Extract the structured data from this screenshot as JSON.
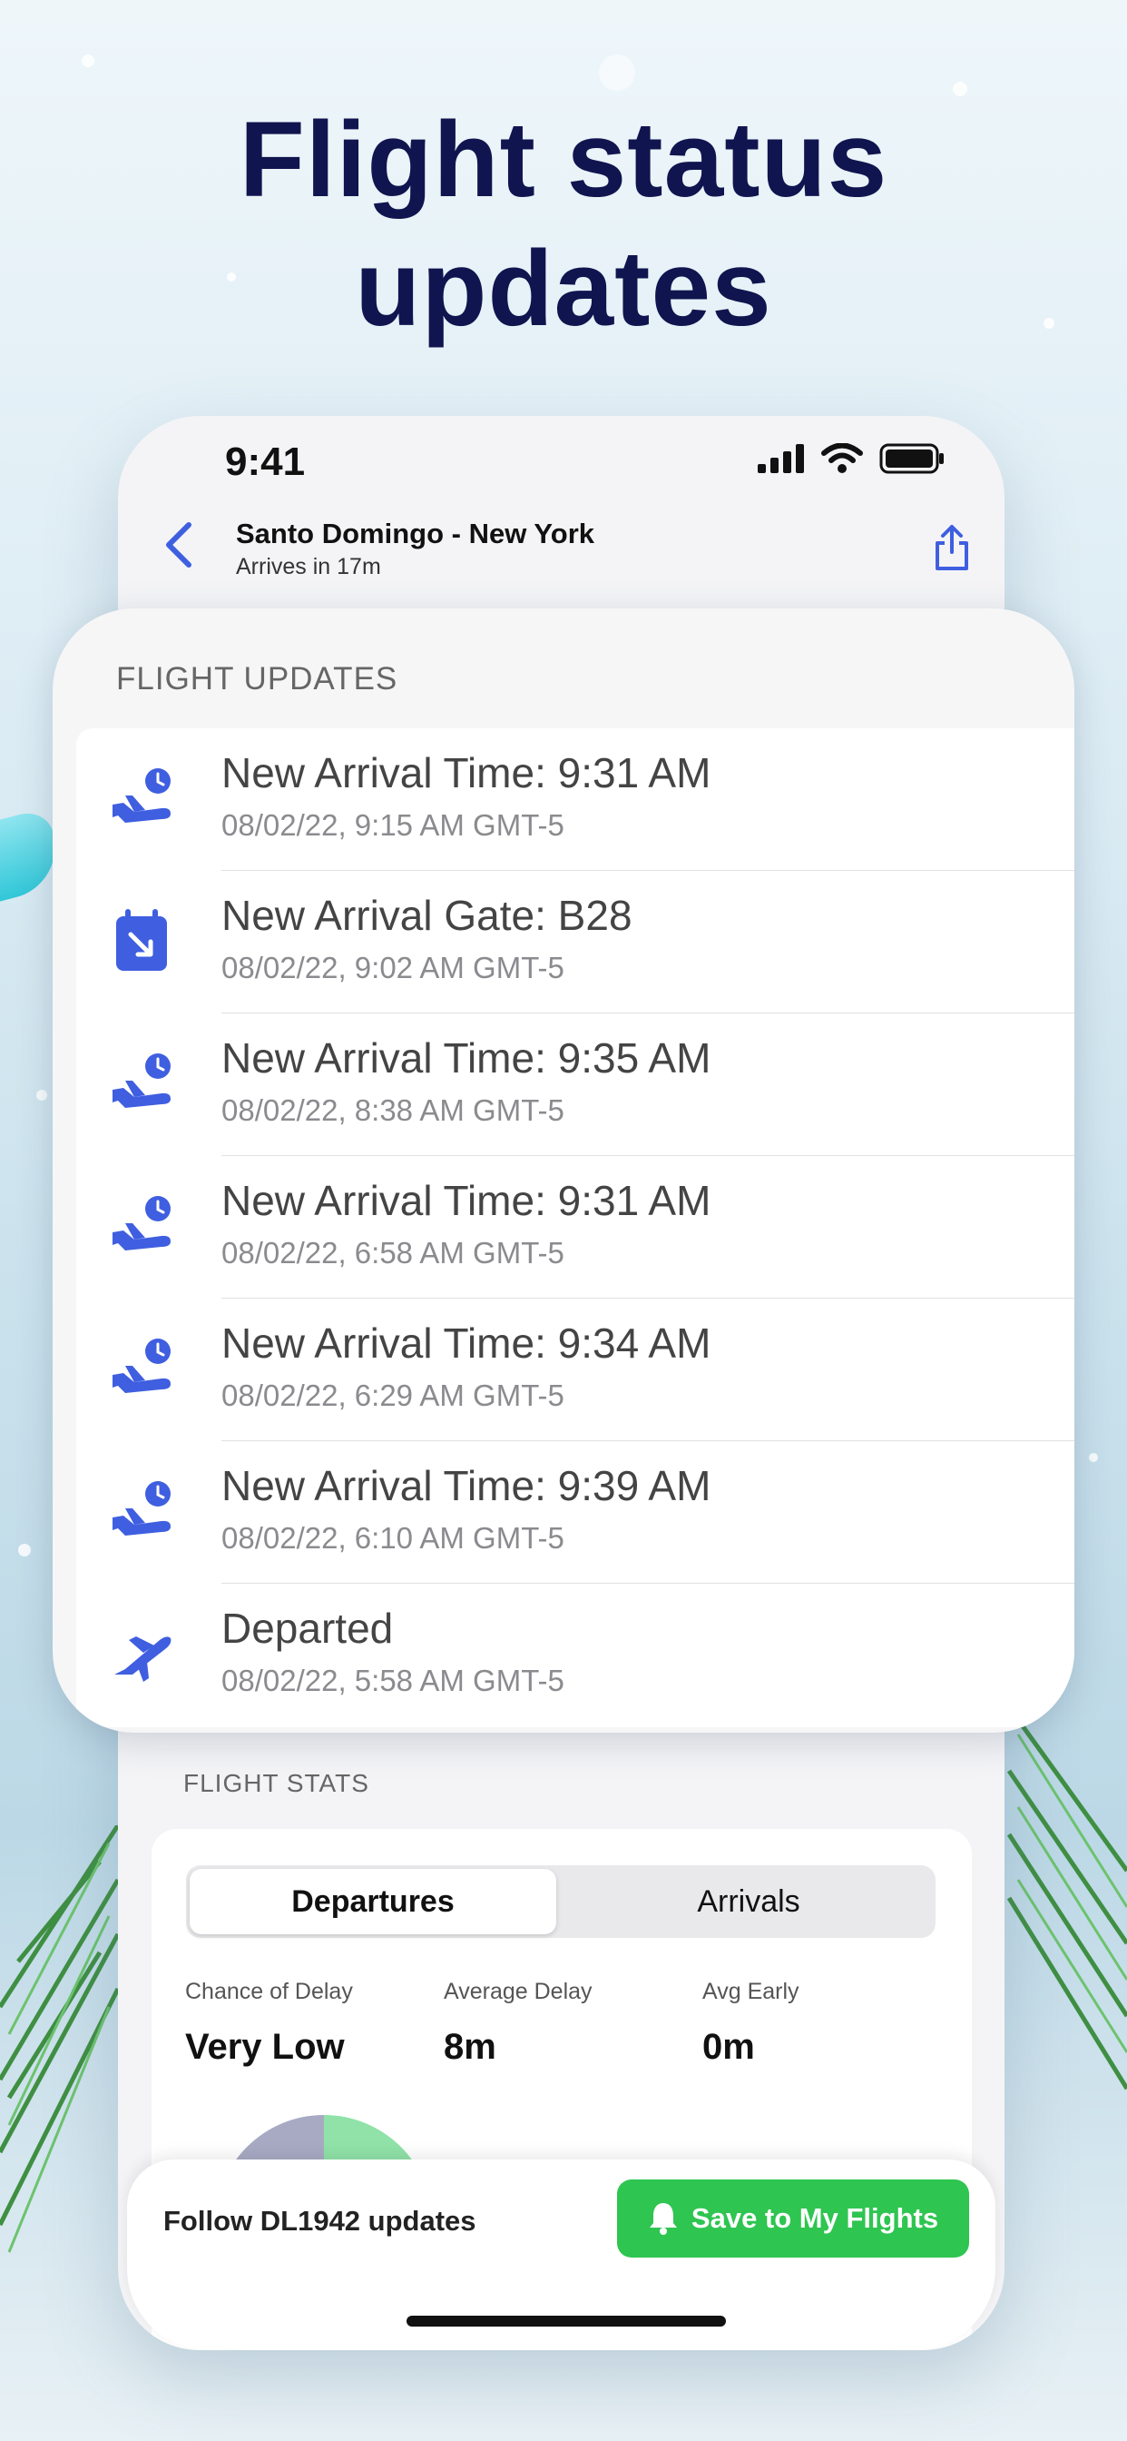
{
  "headline": {
    "line1": "Flight status",
    "line2": "updates"
  },
  "status_bar": {
    "time": "9:41"
  },
  "nav": {
    "title": "Santo Domingo - New York",
    "subtitle": "Arrives in 17m"
  },
  "updates": {
    "section_title": "FLIGHT UPDATES",
    "items": [
      {
        "icon": "plane-clock-icon",
        "title": "New Arrival Time: 9:31 AM",
        "subtitle": "08/02/22, 9:15 AM GMT-5"
      },
      {
        "icon": "gate-calendar-icon",
        "title": "New Arrival Gate: B28",
        "subtitle": "08/02/22, 9:02 AM GMT-5"
      },
      {
        "icon": "plane-clock-icon",
        "title": "New Arrival Time: 9:35 AM",
        "subtitle": "08/02/22, 8:38 AM GMT-5"
      },
      {
        "icon": "plane-clock-icon",
        "title": "New Arrival Time: 9:31 AM",
        "subtitle": "08/02/22, 6:58 AM GMT-5"
      },
      {
        "icon": "plane-clock-icon",
        "title": "New Arrival Time: 9:34 AM",
        "subtitle": "08/02/22, 6:29 AM GMT-5"
      },
      {
        "icon": "plane-clock-icon",
        "title": "New Arrival Time: 9:39 AM",
        "subtitle": "08/02/22, 6:10 AM GMT-5"
      },
      {
        "icon": "plane-departure-icon",
        "title": "Departed",
        "subtitle": "08/02/22, 5:58 AM GMT-5"
      }
    ]
  },
  "stats": {
    "section_title": "FLIGHT STATS",
    "tabs": {
      "active": "Departures",
      "inactive": "Arrivals"
    },
    "chance_label": "Chance of Delay",
    "chance_value": "Very Low",
    "avg_delay_label": "Average Delay",
    "avg_delay_value": "8m",
    "avg_early_label": "Avg Early",
    "avg_early_value": "0m"
  },
  "follow": {
    "text": "Follow DL1942 updates",
    "button": "Save to My Flights"
  },
  "colors": {
    "accent": "#3f5fe0",
    "headline": "#10154f",
    "save": "#2ec550"
  }
}
